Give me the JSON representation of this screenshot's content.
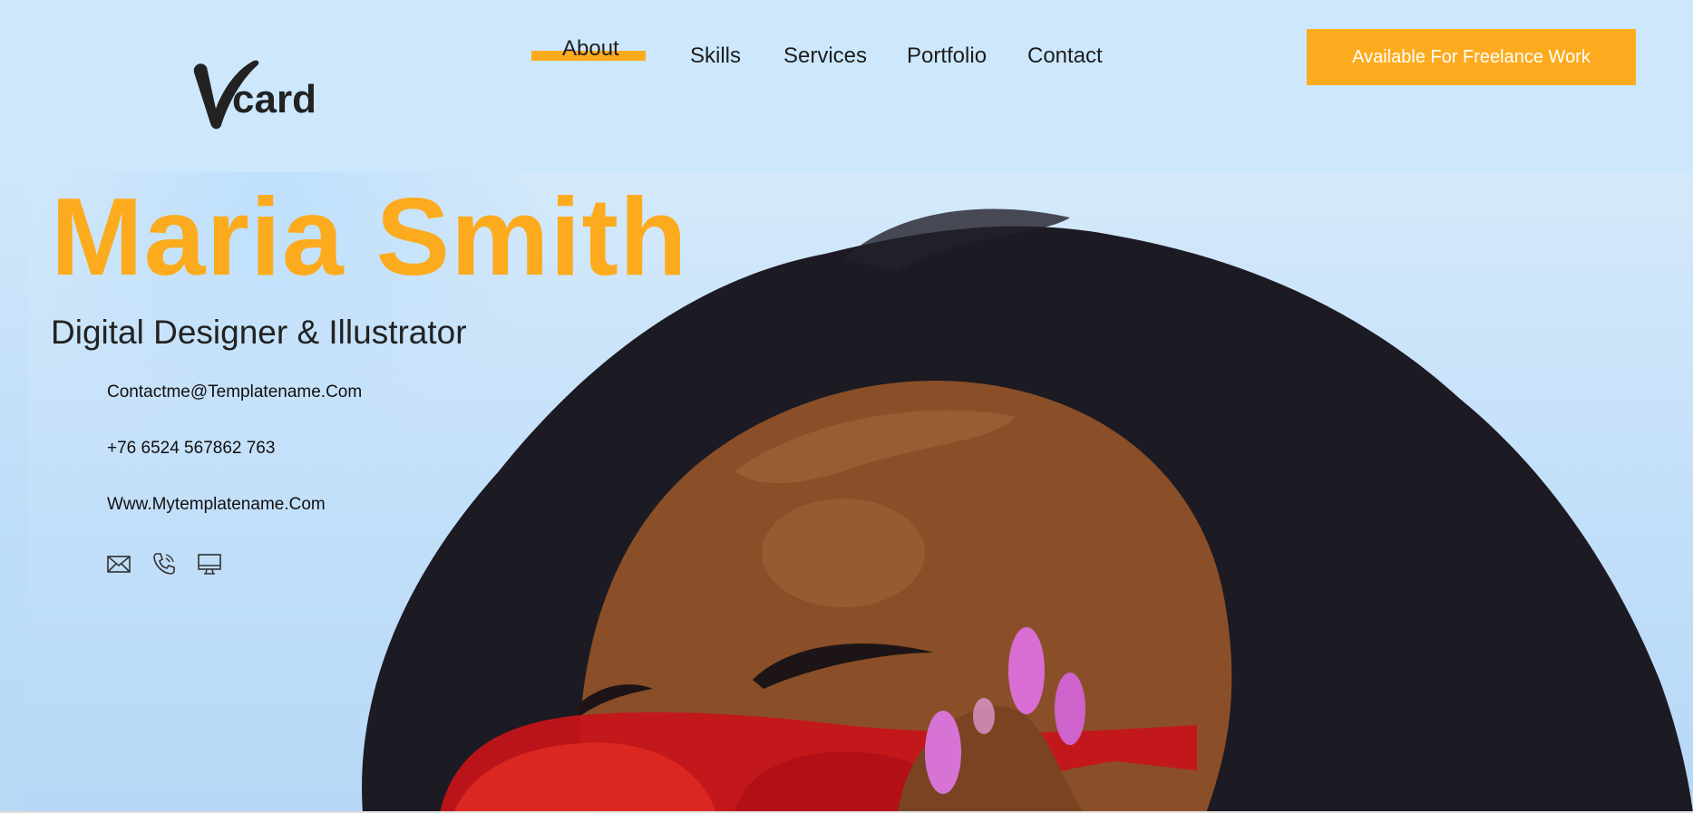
{
  "header": {
    "logo_text_big": "V",
    "logo_text": "card",
    "nav": [
      {
        "label": "About",
        "active": true
      },
      {
        "label": "Skills",
        "active": false
      },
      {
        "label": "Services",
        "active": false
      },
      {
        "label": "Portfolio",
        "active": false
      },
      {
        "label": "Contact",
        "active": false
      }
    ],
    "cta_label": "Available For Freelance Work"
  },
  "hero": {
    "name": "Maria Smith",
    "title": "Digital Designer & Illustrator",
    "email": "Contactme@Templatename.Com",
    "phone": "+76 6524 567862 763",
    "website": "Www.Mytemplatename.Com",
    "icons": [
      "mail-icon",
      "phone-icon",
      "monitor-icon"
    ]
  },
  "colors": {
    "accent": "#fdab1e",
    "background": "#cde8fd",
    "text": "#222222"
  }
}
